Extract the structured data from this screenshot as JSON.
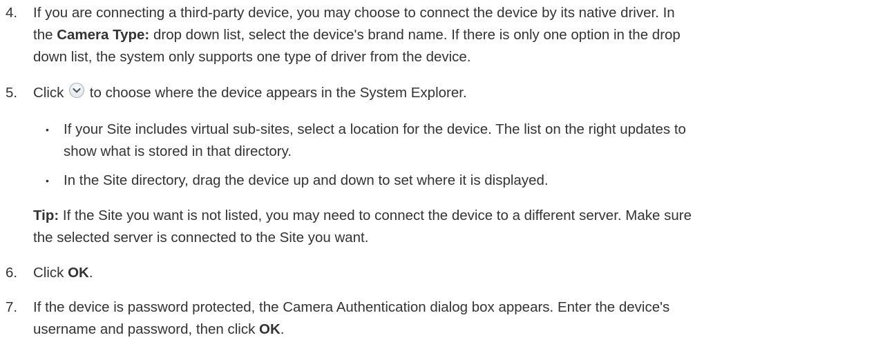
{
  "steps": [
    {
      "number": "4.",
      "line1": "If you are connecting a third-party device, you may choose to connect the device by its native driver. In",
      "line2_pre": "the ",
      "line2_bold": "Camera Type:",
      "line2_post": " drop down list, select the device's brand name. If there is only one option in the drop",
      "line3": "down list, the system only supports one type of driver from the device."
    },
    {
      "number": "5.",
      "pre": "Click ",
      "icon": "chevron-down-circle-icon",
      "post": " to choose where the device appears in the System Explorer.",
      "bullets": [
        {
          "line1": "If your Site includes virtual sub-sites, select a location for the device. The list on the right updates to",
          "line2": "show what is stored in that directory."
        },
        {
          "line1": "In the Site directory, drag the device up and down to set where it is displayed."
        }
      ],
      "tip_label": "Tip:",
      "tip_line1": " If the Site you want is not listed, you may need to connect the device to a different server. Make sure",
      "tip_line2": "the selected server is connected to the Site you want."
    },
    {
      "number": "6.",
      "pre": "Click ",
      "bold": "OK",
      "post": "."
    },
    {
      "number": "7.",
      "line1": "If the device is password protected, the Camera Authentication dialog box appears. Enter the device's",
      "line2_pre": "username and password, then click ",
      "line2_bold": "OK",
      "line2_post": "."
    }
  ],
  "bullet_symbol": "•"
}
